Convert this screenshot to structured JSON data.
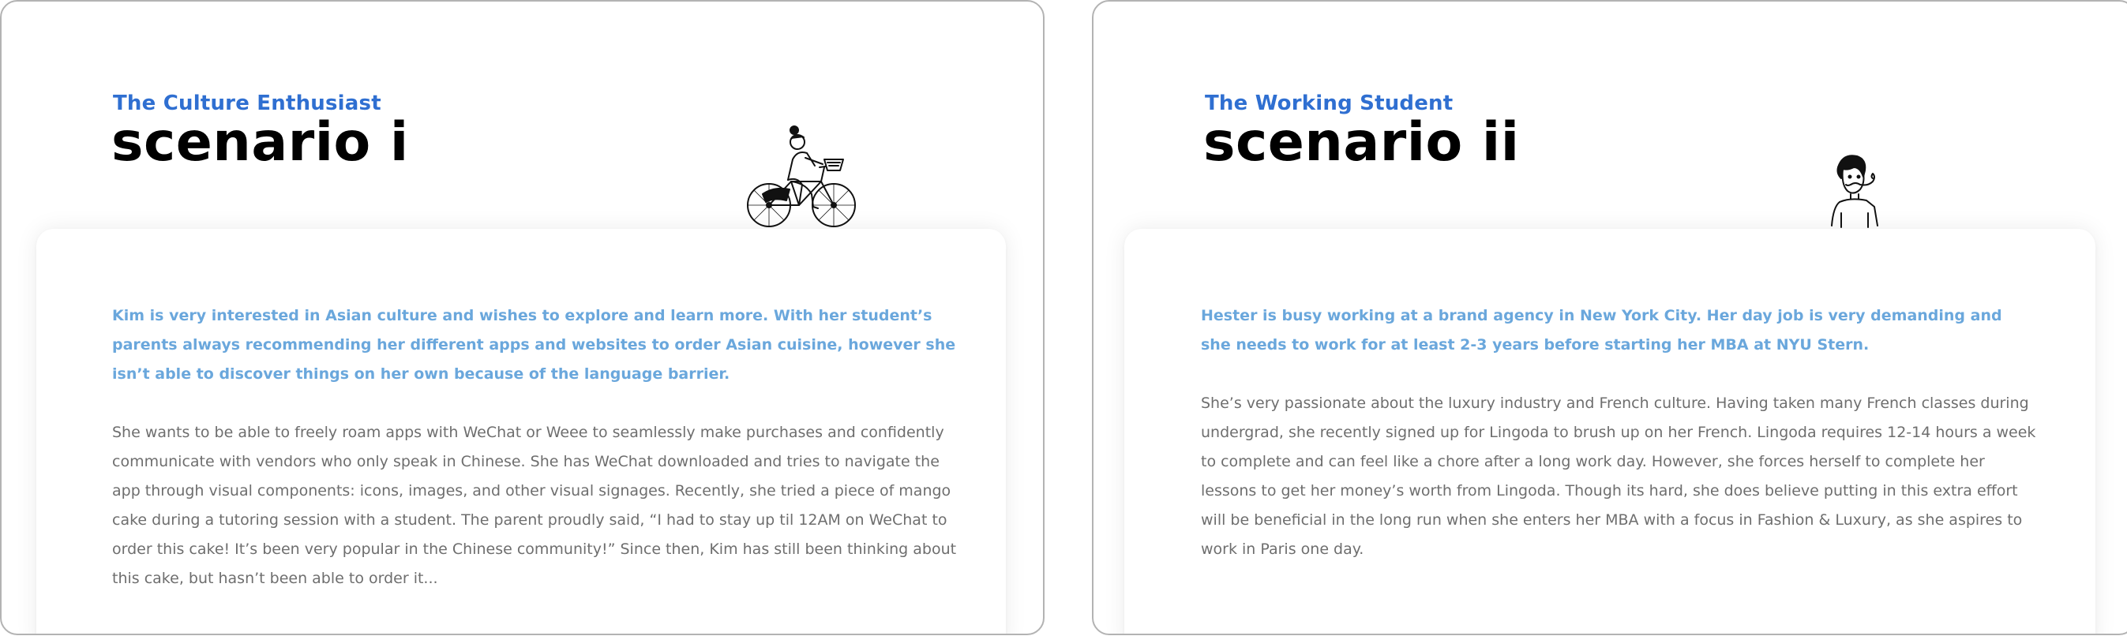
{
  "scenarios": [
    {
      "persona": "The Culture Enthusiast",
      "title": "scenario i",
      "illustration": "woman-on-bicycle-illustration",
      "intro": "Kim is very interested in Asian culture and wishes to explore and learn more. With her student’s parents always recommending her different apps and websites to order Asian cuisine, however she isn’t able to discover things on her own because of the language barrier.",
      "body": "She wants to be able to freely roam apps with WeChat or Weee to seamlessly make purchases and confidently communicate with vendors who only speak in Chinese. She has WeChat downloaded and tries to navigate the app through visual components: icons, images, and other visual signages. Recently, she tried a piece of mango cake during a tutoring session with a student. The parent proudly said, “I had to stay up til 12AM on WeChat to order this cake! It’s been very popular in the Chinese community!” Since then, Kim has still been thinking about this cake, but hasn’t been able to order it..."
    },
    {
      "persona": "The Working Student",
      "title": "scenario ii",
      "illustration": "person-with-mustache-illustration",
      "intro": "Hester is busy working at a brand agency in New York City. Her day job is very demanding and she needs to work for at least 2-3 years before starting her MBA at NYU Stern.",
      "body": "She’s very passionate about the luxury industry and French culture. Having taken many French classes during undergrad, she recently signed up for Lingoda to brush up on her French. Lingoda requires 12-14 hours a week to complete and can feel like a chore after a long work day. However, she forces herself to complete her lessons to get her money’s worth from Lingoda. Though its hard, she does believe putting in this extra effort will be beneficial in the long run when she enters her MBA with a focus in Fashion & Luxury, as she aspires to work in Paris one day."
    }
  ],
  "colors": {
    "persona": "#2f6fd1",
    "intro": "#6aa7dc",
    "body": "#6e6e6e",
    "border": "#b3b3b3"
  }
}
